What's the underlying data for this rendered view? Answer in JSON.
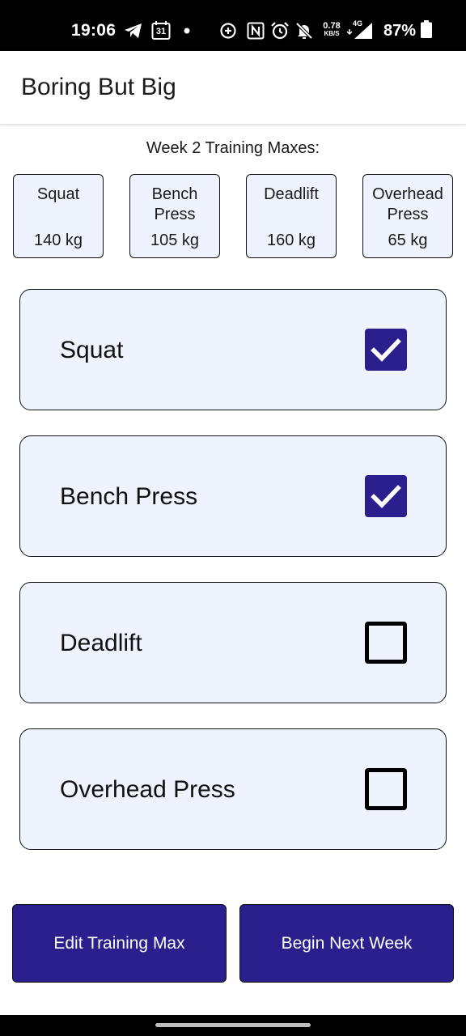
{
  "status_bar": {
    "time": "19:06",
    "calendar_day": "31",
    "net_speed_value": "0.78",
    "net_speed_unit": "KB/S",
    "network_type": "4G",
    "battery_percent": "87%",
    "icons": [
      "telegram-icon",
      "calendar-icon",
      "dot-icon",
      "data-saver-icon",
      "nfc-icon",
      "alarm-icon",
      "mute-icon",
      "signal-icon",
      "battery-icon"
    ]
  },
  "app_bar": {
    "title": "Boring But Big"
  },
  "training_maxes": {
    "heading": "Week 2 Training Maxes:",
    "items": [
      {
        "name": "Squat",
        "value": "140 kg"
      },
      {
        "name": "Bench Press",
        "value": "105 kg"
      },
      {
        "name": "Deadlift",
        "value": "160 kg"
      },
      {
        "name": "Overhead Press",
        "value": "65 kg"
      }
    ]
  },
  "exercises": [
    {
      "label": "Squat",
      "checked": true
    },
    {
      "label": "Bench Press",
      "checked": true
    },
    {
      "label": "Deadlift",
      "checked": false
    },
    {
      "label": "Overhead Press",
      "checked": false
    }
  ],
  "buttons": {
    "edit_training_max": "Edit Training Max",
    "begin_next_week": "Begin Next Week"
  },
  "colors": {
    "accent": "#2a1f8c",
    "card_background": "#eef3fd",
    "status_bar": "#000000"
  }
}
